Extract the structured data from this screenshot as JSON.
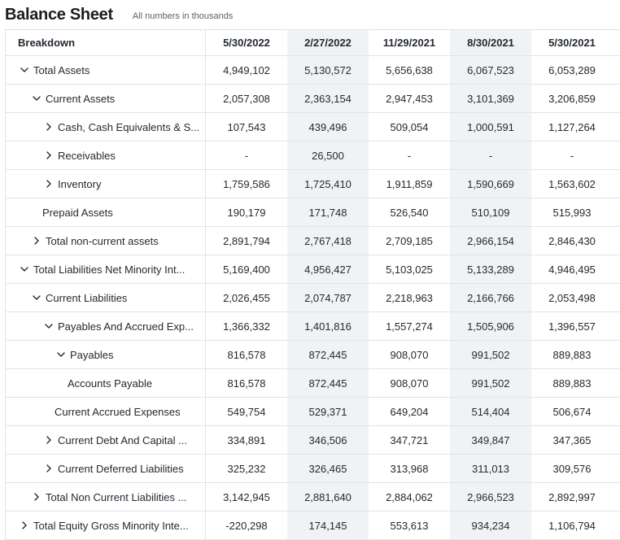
{
  "header": {
    "title": "Balance Sheet",
    "subtitle": "All numbers in thousands"
  },
  "columns": {
    "breakdown": "Breakdown",
    "dates": [
      "5/30/2022",
      "2/27/2022",
      "11/29/2021",
      "8/30/2021",
      "5/30/2021"
    ]
  },
  "rows": [
    {
      "label": "Total Assets",
      "expander": "expanded",
      "values": [
        "4,949,102",
        "5,130,572",
        "5,656,638",
        "6,067,523",
        "6,053,289"
      ]
    },
    {
      "label": "Current Assets",
      "expander": "expanded",
      "values": [
        "2,057,308",
        "2,363,154",
        "2,947,453",
        "3,101,369",
        "3,206,859"
      ]
    },
    {
      "label": "Cash, Cash Equivalents & S...",
      "expander": "collapsed",
      "values": [
        "107,543",
        "439,496",
        "509,054",
        "1,000,591",
        "1,127,264"
      ]
    },
    {
      "label": "Receivables",
      "expander": "collapsed",
      "values": [
        "-",
        "26,500",
        "-",
        "-",
        "-"
      ]
    },
    {
      "label": "Inventory",
      "expander": "collapsed",
      "values": [
        "1,759,586",
        "1,725,410",
        "1,911,859",
        "1,590,669",
        "1,563,602"
      ]
    },
    {
      "label": "Prepaid Assets",
      "expander": "none",
      "values": [
        "190,179",
        "171,748",
        "526,540",
        "510,109",
        "515,993"
      ]
    },
    {
      "label": "Total non-current assets",
      "expander": "collapsed",
      "values": [
        "2,891,794",
        "2,767,418",
        "2,709,185",
        "2,966,154",
        "2,846,430"
      ]
    },
    {
      "label": "Total Liabilities Net Minority Int...",
      "expander": "expanded",
      "values": [
        "5,169,400",
        "4,956,427",
        "5,103,025",
        "5,133,289",
        "4,946,495"
      ]
    },
    {
      "label": "Current Liabilities",
      "expander": "expanded",
      "values": [
        "2,026,455",
        "2,074,787",
        "2,218,963",
        "2,166,766",
        "2,053,498"
      ]
    },
    {
      "label": "Payables And Accrued Exp...",
      "expander": "expanded",
      "values": [
        "1,366,332",
        "1,401,816",
        "1,557,274",
        "1,505,906",
        "1,396,557"
      ]
    },
    {
      "label": "Payables",
      "expander": "expanded",
      "values": [
        "816,578",
        "872,445",
        "908,070",
        "991,502",
        "889,883"
      ]
    },
    {
      "label": "Accounts Payable",
      "expander": "none",
      "values": [
        "816,578",
        "872,445",
        "908,070",
        "991,502",
        "889,883"
      ]
    },
    {
      "label": "Current Accrued Expenses",
      "expander": "none",
      "values": [
        "549,754",
        "529,371",
        "649,204",
        "514,404",
        "506,674"
      ]
    },
    {
      "label": "Current Debt And Capital ...",
      "expander": "collapsed",
      "values": [
        "334,891",
        "346,506",
        "347,721",
        "349,847",
        "347,365"
      ]
    },
    {
      "label": "Current Deferred Liabilities",
      "expander": "collapsed",
      "values": [
        "325,232",
        "326,465",
        "313,968",
        "311,013",
        "309,576"
      ]
    },
    {
      "label": "Total Non Current Liabilities ...",
      "expander": "collapsed",
      "values": [
        "3,142,945",
        "2,881,640",
        "2,884,062",
        "2,966,523",
        "2,892,997"
      ]
    },
    {
      "label": "Total Equity Gross Minority Inte...",
      "expander": "collapsed",
      "values": [
        "-220,298",
        "174,145",
        "553,613",
        "934,234",
        "1,106,794"
      ]
    }
  ],
  "icons": {
    "expanded": "chevron-down-icon",
    "collapsed": "chevron-right-icon"
  }
}
